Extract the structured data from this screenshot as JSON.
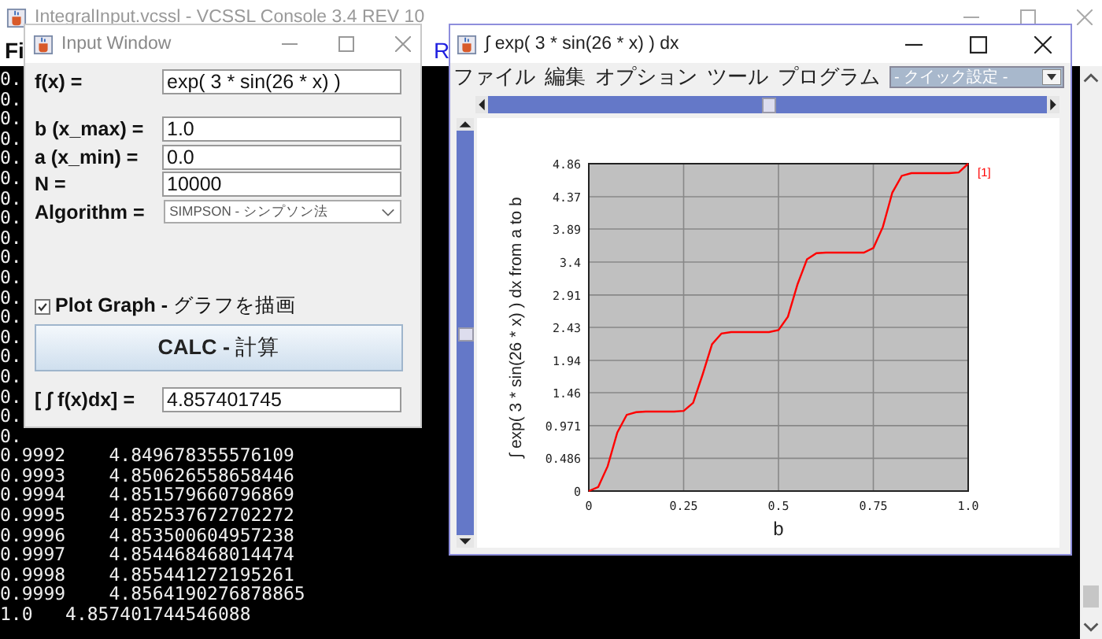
{
  "console": {
    "title": "IntegralInput.vcssl - VCSSL Console 3.4  REV 10",
    "menu": [
      {
        "label": "Fi",
        "kind": "plain"
      },
      {
        "label": "R",
        "kind": "link"
      }
    ],
    "lines": [
      "0.",
      "0.",
      "0.",
      "0.",
      "0.",
      "0.",
      "0.",
      "0.",
      "0.",
      "0.",
      "0.",
      "0.",
      "0.",
      "0.",
      "0.",
      "0.",
      "0.",
      "0.",
      "0.",
      "0.9992    4.849678355576109",
      "0.9993    4.850626558658446",
      "0.9994    4.851579660796869",
      "0.9995    4.852537672702272",
      "0.9996    4.853500604957238",
      "0.9997    4.854468468014474",
      "0.9998    4.855441272195261",
      "0.9999    4.8564190276878865",
      "1.0   4.857401744546088"
    ]
  },
  "input_window": {
    "title": "Input Window",
    "fields": [
      {
        "label": "f(x) =",
        "value": "exp( 3 * sin(26 * x) )"
      },
      {
        "label": "b (x_max) =",
        "value": "1.0"
      },
      {
        "label": "a (x_min) =",
        "value": "0.0"
      },
      {
        "label": "N =",
        "value": "10000"
      }
    ],
    "algorithm": {
      "label": "Algorithm =",
      "value": "SIMPSON - シンプソン法"
    },
    "plot_graph": {
      "label": "**Plot Graph -** グラフを描画",
      "checked": true
    },
    "calc_button": "**CALC -** 計算",
    "result": {
      "label": "[ ∫ f(x)dx] =",
      "value": "4.857401745"
    }
  },
  "graph_window": {
    "title": "∫ exp( 3 * sin(26 * x) ) dx",
    "menu": [
      "ファイル",
      "編集",
      "オプション",
      "ツール",
      "プログラム"
    ],
    "quick_setting": "- クイック設定 -",
    "h_slider": {
      "level": 0.5
    },
    "v_slider": {
      "level": 0.5
    },
    "chart_data": {
      "type": "line",
      "xlabel": "b",
      "ylabel": "∫ exp( 3 * sin(26 * x) ) dx   from  a  to  b",
      "x": [
        0,
        0.025,
        0.05,
        0.075,
        0.1,
        0.125,
        0.15,
        0.175,
        0.2,
        0.225,
        0.25,
        0.275,
        0.3,
        0.325,
        0.35,
        0.375,
        0.4,
        0.425,
        0.45,
        0.475,
        0.5,
        0.525,
        0.55,
        0.575,
        0.6,
        0.625,
        0.65,
        0.675,
        0.7,
        0.725,
        0.75,
        0.775,
        0.8,
        0.825,
        0.85,
        0.875,
        0.9,
        0.925,
        0.95,
        0.975,
        1.0
      ],
      "series": [
        {
          "name": "[1]",
          "color": "#ff0000",
          "values": [
            0,
            0.06,
            0.37,
            0.87,
            1.13,
            1.17,
            1.18,
            1.18,
            1.18,
            1.18,
            1.19,
            1.31,
            1.73,
            2.18,
            2.34,
            2.36,
            2.36,
            2.36,
            2.36,
            2.36,
            2.39,
            2.59,
            3.07,
            3.44,
            3.53,
            3.54,
            3.54,
            3.54,
            3.54,
            3.54,
            3.61,
            3.92,
            4.43,
            4.68,
            4.72,
            4.72,
            4.72,
            4.72,
            4.72,
            4.73,
            4.86
          ]
        }
      ],
      "grid": true,
      "xlim": [
        0,
        1
      ],
      "ylim": [
        0,
        4.86
      ],
      "xticks": [
        0,
        0.25,
        0.5,
        0.75,
        {
          "value": 1,
          "label": "1.0"
        }
      ],
      "yticks": [
        0,
        0.486,
        0.971,
        1.46,
        1.94,
        2.43,
        2.91,
        3.4,
        3.89,
        4.37,
        4.86
      ]
    }
  }
}
